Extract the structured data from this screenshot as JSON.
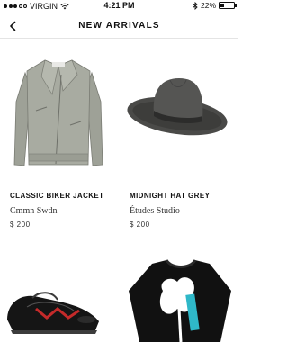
{
  "status_bar": {
    "carrier": "VIRGIN",
    "time": "4:21 PM",
    "battery": "22%",
    "battery_level": 0.22,
    "icons": [
      "signal-dots-icon",
      "wifi-icon",
      "bluetooth-icon",
      "battery-icon"
    ]
  },
  "nav": {
    "back_icon": "chevron-left-icon",
    "title": "NEW ARRIVALS"
  },
  "products": [
    {
      "name": "CLASSIC BIKER JACKET",
      "brand": "Cmmn Swdn",
      "price": "$ 200",
      "image": "grey-leather-biker-jacket"
    },
    {
      "name": "MIDNIGHT HAT GREY",
      "brand": "Études Studio",
      "price": "$ 200",
      "image": "grey-wide-brim-felt-hat"
    },
    {
      "name": "",
      "brand": "",
      "price": "",
      "image": "black-leather-derby-shoes"
    },
    {
      "name": "",
      "brand": "",
      "price": "",
      "image": "black-graphic-sweater"
    }
  ],
  "colors": {
    "background": "#ffffff",
    "text": "#111111",
    "divider": "#e4e4e4"
  }
}
